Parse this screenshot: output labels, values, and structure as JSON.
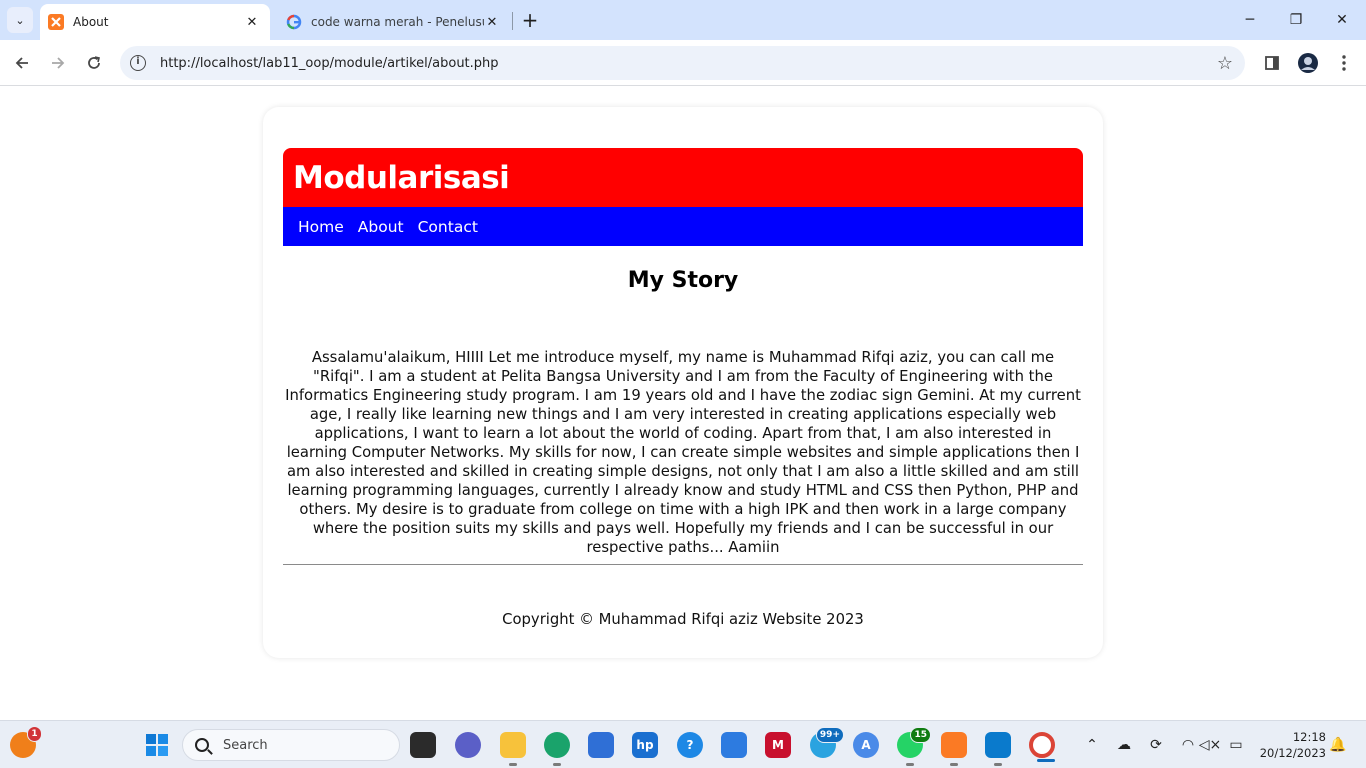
{
  "browser": {
    "tabs": [
      {
        "title": "About",
        "active": true,
        "icon": "xampp-icon"
      },
      {
        "title": "code warna merah - Penelusura",
        "active": false,
        "icon": "google-icon"
      }
    ],
    "url": "http://localhost/lab11_oop/module/artikel/about.php",
    "window_controls": {
      "minimize": "─",
      "restore": "❐",
      "close": "✕"
    }
  },
  "page": {
    "header_title": "Modularisasi",
    "nav": [
      "Home",
      "About",
      "Contact"
    ],
    "story_title": "My Story",
    "story_text": "Assalamu'alaikum, HIIII Let me introduce myself, my name is Muhammad Rifqi aziz, you can call me \"Rifqi\". I am a student at Pelita Bangsa University and I am from the Faculty of Engineering with the Informatics Engineering study program. I am 19 years old and I have the zodiac sign Gemini. At my current age, I really like learning new things and I am very interested in creating applications especially web applications, I want to learn a lot about the world of coding. Apart from that, I am also interested in learning Computer Networks. My skills for now, I can create simple websites and simple applications then I am also interested and skilled in creating simple designs, not only that I am also a little skilled and am still learning programming languages, currently I already know and study HTML and CSS then Python, PHP and others. My desire is to graduate from college on time with a high IPK and then work in a large company where the position suits my skills and pays well. Hopefully my friends and I can be successful in our respective paths... Aamiin",
    "footer": "Copyright © Muhammad Rifqi aziz Website 2023",
    "colors": {
      "header": "#ff0000",
      "nav": "#0000ff"
    }
  },
  "taskbar": {
    "search_placeholder": "Search",
    "badges": {
      "weather": "1",
      "telegram": "99+",
      "whatsapp": "15"
    },
    "time": "12:18",
    "date": "20/12/2023"
  }
}
